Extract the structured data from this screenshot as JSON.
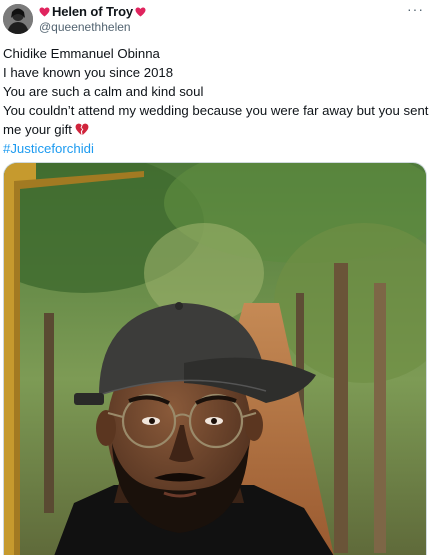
{
  "author": {
    "display_name": "Helen of Troy",
    "handle": "@queenethhelen",
    "avatar_icon": "profile-photo",
    "name_emoji": "heart-icon",
    "heart_color": "#e0245e"
  },
  "menu": {
    "more_glyph": "···"
  },
  "tweet": {
    "lines": [
      "Chidike Emmanuel Obinna",
      "I have known you since 2018",
      "You are such a calm and kind soul",
      "You couldn’t attend my wedding because you were far away but you sent",
      "me your gift"
    ],
    "hashtag": "#Justiceforchidi",
    "hashtag_color": "#1d9bf0",
    "trailing_emoji": "broken-heart-icon"
  },
  "media": {
    "alt_subject": "photo",
    "accent_frame_color": "#c69a2e"
  }
}
